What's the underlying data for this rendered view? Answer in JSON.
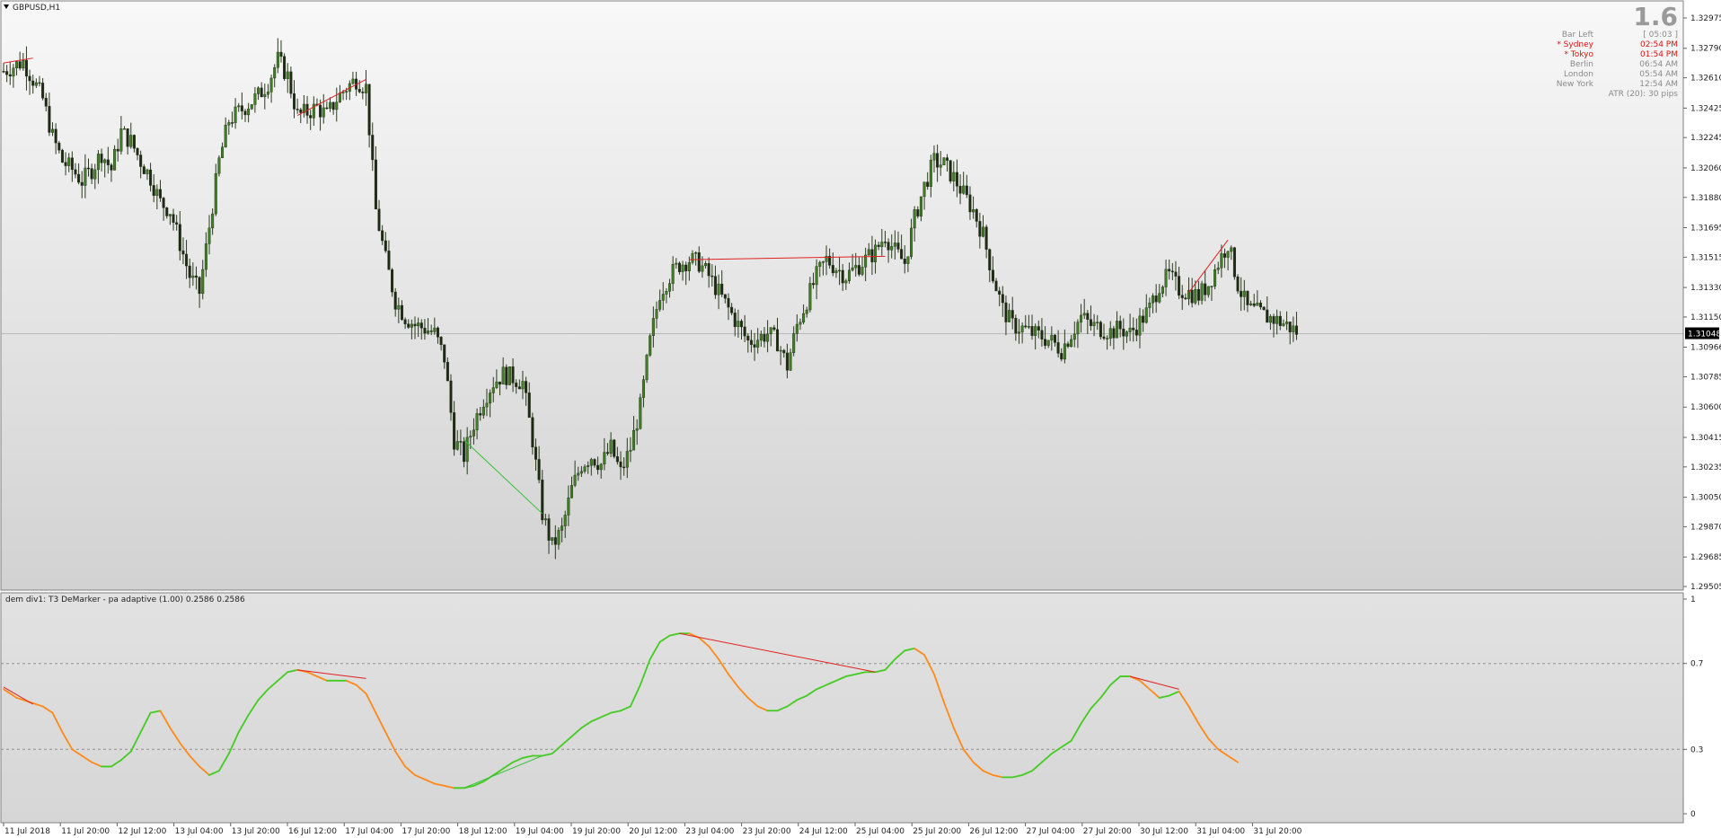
{
  "window": {
    "title": "GBPUSD,H1"
  },
  "indicator": {
    "label": "dem div1: T3 DeMarker - pa adaptive (1.00) 0.2586 0.2586"
  },
  "info_panel": {
    "big_value": "1.6",
    "bar_left_label": "Bar Left",
    "bar_left_value": "[ 05:03 ]",
    "clocks": [
      {
        "city": "* Sydney",
        "time": "02:54 PM",
        "highlight": true
      },
      {
        "city": "* Tokyo",
        "time": "01:54 PM",
        "highlight": true
      },
      {
        "city": "Berlin",
        "time": "06:54 AM",
        "highlight": false
      },
      {
        "city": "London",
        "time": "05:54 AM",
        "highlight": false
      },
      {
        "city": "New York",
        "time": "12:54 AM",
        "highlight": false
      }
    ],
    "atr": "ATR (20): 30 pips"
  },
  "price_axis": {
    "labels": [
      "1.32975",
      "1.32790",
      "1.32610",
      "1.32425",
      "1.32245",
      "1.32060",
      "1.31880",
      "1.31695",
      "1.31515",
      "1.31330",
      "1.31150",
      "1.30966",
      "1.30785",
      "1.30600",
      "1.30415",
      "1.30235",
      "1.30050",
      "1.29870",
      "1.29685",
      "1.29505"
    ],
    "current_price": "1.31048"
  },
  "indicator_axis": {
    "labels": [
      "1",
      "0.7",
      "0.3",
      "0"
    ],
    "levels": [
      0.7,
      0.3
    ]
  },
  "time_axis": {
    "labels": [
      "11 Jul 2018",
      "11 Jul 20:00",
      "12 Jul 12:00",
      "13 Jul 04:00",
      "13 Jul 20:00",
      "16 Jul 12:00",
      "17 Jul 04:00",
      "17 Jul 20:00",
      "18 Jul 12:00",
      "19 Jul 04:00",
      "19 Jul 20:00",
      "20 Jul 12:00",
      "23 Jul 04:00",
      "23 Jul 20:00",
      "24 Jul 12:00",
      "25 Jul 04:00",
      "25 Jul 20:00",
      "26 Jul 12:00",
      "27 Jul 04:00",
      "27 Jul 20:00",
      "30 Jul 12:00",
      "31 Jul 04:00",
      "31 Jul 20:00"
    ]
  },
  "colors": {
    "bull_candle": "#3f7f22",
    "bear_candle": "#1e2a14",
    "divergence_bearish": "#e02020",
    "divergence_bullish": "#30c030",
    "dem_up": "#44cc22",
    "dem_down": "#ff8a1a",
    "highlight_text": "#e01010"
  },
  "chart_data": {
    "type": "candlestick",
    "symbol": "GBPUSD",
    "timeframe": "H1",
    "ylim": [
      1.29505,
      1.32975
    ],
    "current_price": 1.31048,
    "price_path": [
      [
        0,
        1.3265
      ],
      [
        3,
        1.3268
      ],
      [
        6,
        1.3271
      ],
      [
        9,
        1.326
      ],
      [
        12,
        1.3248
      ],
      [
        15,
        1.3225
      ],
      [
        18,
        1.321
      ],
      [
        21,
        1.3205
      ],
      [
        24,
        1.3198
      ],
      [
        27,
        1.3205
      ],
      [
        30,
        1.3215
      ],
      [
        33,
        1.3205
      ],
      [
        36,
        1.3228
      ],
      [
        39,
        1.3222
      ],
      [
        42,
        1.321
      ],
      [
        45,
        1.32
      ],
      [
        48,
        1.3185
      ],
      [
        51,
        1.318
      ],
      [
        54,
        1.316
      ],
      [
        57,
        1.314
      ],
      [
        60,
        1.313
      ],
      [
        63,
        1.317
      ],
      [
        66,
        1.321
      ],
      [
        69,
        1.3235
      ],
      [
        72,
        1.324
      ],
      [
        75,
        1.3245
      ],
      [
        78,
        1.325
      ],
      [
        81,
        1.3258
      ],
      [
        84,
        1.3272
      ],
      [
        87,
        1.3262
      ],
      [
        90,
        1.3238
      ],
      [
        93,
        1.324
      ],
      [
        96,
        1.3243
      ],
      [
        99,
        1.3238
      ],
      [
        102,
        1.3248
      ],
      [
        105,
        1.3255
      ],
      [
        108,
        1.326
      ],
      [
        111,
        1.3255
      ],
      [
        114,
        1.318
      ],
      [
        117,
        1.315
      ],
      [
        120,
        1.3125
      ],
      [
        123,
        1.3115
      ],
      [
        126,
        1.311
      ],
      [
        129,
        1.3108
      ],
      [
        132,
        1.3105
      ],
      [
        135,
        1.309
      ],
      [
        138,
        1.304
      ],
      [
        141,
        1.303
      ],
      [
        144,
        1.305
      ],
      [
        147,
        1.3065
      ],
      [
        150,
        1.3075
      ],
      [
        153,
        1.308
      ],
      [
        156,
        1.3078
      ],
      [
        159,
        1.3075
      ],
      [
        162,
        1.304
      ],
      [
        165,
        1.2995
      ],
      [
        168,
        1.2975
      ],
      [
        171,
        1.2985
      ],
      [
        174,
        1.301
      ],
      [
        177,
        1.3025
      ],
      [
        180,
        1.303
      ],
      [
        183,
        1.3025
      ],
      [
        186,
        1.3035
      ],
      [
        189,
        1.302
      ],
      [
        192,
        1.3035
      ],
      [
        195,
        1.306
      ],
      [
        198,
        1.31
      ],
      [
        201,
        1.313
      ],
      [
        204,
        1.314
      ],
      [
        207,
        1.3147
      ],
      [
        210,
        1.315
      ],
      [
        213,
        1.3148
      ],
      [
        216,
        1.314
      ],
      [
        219,
        1.313
      ],
      [
        222,
        1.312
      ],
      [
        225,
        1.311
      ],
      [
        228,
        1.31
      ],
      [
        231,
        1.3102
      ],
      [
        234,
        1.3105
      ],
      [
        237,
        1.31
      ],
      [
        240,
        1.3085
      ],
      [
        243,
        1.311
      ],
      [
        246,
        1.3125
      ],
      [
        249,
        1.314
      ],
      [
        252,
        1.315
      ],
      [
        255,
        1.3145
      ],
      [
        258,
        1.314
      ],
      [
        261,
        1.3145
      ],
      [
        264,
        1.315
      ],
      [
        267,
        1.3155
      ],
      [
        270,
        1.3165
      ],
      [
        273,
        1.3155
      ],
      [
        276,
        1.3148
      ],
      [
        279,
        1.3175
      ],
      [
        282,
        1.3195
      ],
      [
        285,
        1.321
      ],
      [
        288,
        1.3208
      ],
      [
        291,
        1.32
      ],
      [
        294,
        1.319
      ],
      [
        297,
        1.318
      ],
      [
        300,
        1.3165
      ],
      [
        303,
        1.314
      ],
      [
        306,
        1.312
      ],
      [
        309,
        1.311
      ],
      [
        312,
        1.3108
      ],
      [
        315,
        1.3105
      ],
      [
        318,
        1.3103
      ],
      [
        321,
        1.31
      ],
      [
        324,
        1.3095
      ],
      [
        327,
        1.3105
      ],
      [
        330,
        1.3115
      ],
      [
        333,
        1.311
      ],
      [
        336,
        1.3108
      ],
      [
        339,
        1.3106
      ],
      [
        342,
        1.3108
      ],
      [
        345,
        1.3105
      ],
      [
        348,
        1.3112
      ],
      [
        351,
        1.312
      ],
      [
        354,
        1.3135
      ],
      [
        357,
        1.314
      ],
      [
        360,
        1.3132
      ],
      [
        363,
        1.313
      ],
      [
        366,
        1.3128
      ],
      [
        369,
        1.3135
      ],
      [
        372,
        1.3148
      ],
      [
        375,
        1.316
      ],
      [
        378,
        1.3135
      ],
      [
        381,
        1.312
      ],
      [
        384,
        1.3118
      ],
      [
        387,
        1.3115
      ],
      [
        390,
        1.3113
      ],
      [
        393,
        1.311
      ],
      [
        396,
        1.3106
      ]
    ],
    "bearish_divergences": [
      [
        [
          0,
          1.327
        ],
        [
          9,
          1.3273
        ]
      ],
      [
        [
          90,
          1.3238
        ],
        [
          111,
          1.326
        ]
      ],
      [
        [
          210,
          1.315
        ],
        [
          270,
          1.3152
        ]
      ],
      [
        [
          363,
          1.313
        ],
        [
          375,
          1.3162
        ]
      ]
    ],
    "bullish_divergences": [
      [
        [
          141,
          1.304
        ],
        [
          165,
          1.2995
        ]
      ]
    ],
    "indicator": {
      "name": "T3 DeMarker - pa adaptive",
      "ylim": [
        0,
        1
      ],
      "levels": [
        0.7,
        0.3
      ],
      "values": [
        [
          0,
          0.58
        ],
        [
          4,
          0.54
        ],
        [
          8,
          0.52
        ],
        [
          12,
          0.5
        ],
        [
          15,
          0.47
        ],
        [
          18,
          0.38
        ],
        [
          21,
          0.3
        ],
        [
          24,
          0.27
        ],
        [
          27,
          0.24
        ],
        [
          30,
          0.22
        ],
        [
          33,
          0.22
        ],
        [
          36,
          0.25
        ],
        [
          39,
          0.29
        ],
        [
          42,
          0.38
        ],
        [
          45,
          0.47
        ],
        [
          48,
          0.48
        ],
        [
          51,
          0.4
        ],
        [
          54,
          0.33
        ],
        [
          57,
          0.27
        ],
        [
          60,
          0.22
        ],
        [
          63,
          0.18
        ],
        [
          66,
          0.2
        ],
        [
          69,
          0.28
        ],
        [
          72,
          0.38
        ],
        [
          75,
          0.46
        ],
        [
          78,
          0.53
        ],
        [
          81,
          0.58
        ],
        [
          84,
          0.62
        ],
        [
          87,
          0.66
        ],
        [
          90,
          0.67
        ],
        [
          93,
          0.66
        ],
        [
          96,
          0.64
        ],
        [
          99,
          0.62
        ],
        [
          102,
          0.62
        ],
        [
          105,
          0.62
        ],
        [
          108,
          0.6
        ],
        [
          111,
          0.56
        ],
        [
          114,
          0.47
        ],
        [
          117,
          0.38
        ],
        [
          120,
          0.29
        ],
        [
          123,
          0.22
        ],
        [
          126,
          0.18
        ],
        [
          129,
          0.16
        ],
        [
          132,
          0.14
        ],
        [
          135,
          0.13
        ],
        [
          138,
          0.12
        ],
        [
          141,
          0.12
        ],
        [
          144,
          0.13
        ],
        [
          147,
          0.15
        ],
        [
          150,
          0.18
        ],
        [
          153,
          0.21
        ],
        [
          156,
          0.24
        ],
        [
          159,
          0.26
        ],
        [
          162,
          0.27
        ],
        [
          165,
          0.27
        ],
        [
          168,
          0.28
        ],
        [
          171,
          0.32
        ],
        [
          174,
          0.36
        ],
        [
          177,
          0.4
        ],
        [
          180,
          0.43
        ],
        [
          183,
          0.45
        ],
        [
          186,
          0.47
        ],
        [
          189,
          0.48
        ],
        [
          192,
          0.5
        ],
        [
          195,
          0.6
        ],
        [
          198,
          0.72
        ],
        [
          201,
          0.8
        ],
        [
          204,
          0.83
        ],
        [
          207,
          0.84
        ],
        [
          210,
          0.84
        ],
        [
          213,
          0.82
        ],
        [
          216,
          0.78
        ],
        [
          219,
          0.72
        ],
        [
          222,
          0.65
        ],
        [
          225,
          0.59
        ],
        [
          228,
          0.54
        ],
        [
          231,
          0.5
        ],
        [
          234,
          0.48
        ],
        [
          237,
          0.48
        ],
        [
          240,
          0.5
        ],
        [
          243,
          0.53
        ],
        [
          246,
          0.55
        ],
        [
          249,
          0.58
        ],
        [
          252,
          0.6
        ],
        [
          255,
          0.62
        ],
        [
          258,
          0.64
        ],
        [
          261,
          0.65
        ],
        [
          264,
          0.66
        ],
        [
          267,
          0.66
        ],
        [
          270,
          0.67
        ],
        [
          273,
          0.72
        ],
        [
          276,
          0.76
        ],
        [
          279,
          0.77
        ],
        [
          282,
          0.74
        ],
        [
          285,
          0.65
        ],
        [
          288,
          0.52
        ],
        [
          291,
          0.4
        ],
        [
          294,
          0.3
        ],
        [
          297,
          0.24
        ],
        [
          300,
          0.2
        ],
        [
          303,
          0.18
        ],
        [
          306,
          0.17
        ],
        [
          309,
          0.17
        ],
        [
          312,
          0.18
        ],
        [
          315,
          0.2
        ],
        [
          318,
          0.24
        ],
        [
          321,
          0.28
        ],
        [
          324,
          0.31
        ],
        [
          327,
          0.34
        ],
        [
          330,
          0.42
        ],
        [
          333,
          0.49
        ],
        [
          336,
          0.54
        ],
        [
          339,
          0.6
        ],
        [
          342,
          0.64
        ],
        [
          345,
          0.64
        ],
        [
          348,
          0.62
        ],
        [
          351,
          0.58
        ],
        [
          354,
          0.54
        ],
        [
          357,
          0.55
        ],
        [
          360,
          0.57
        ],
        [
          363,
          0.5
        ],
        [
          366,
          0.42
        ],
        [
          369,
          0.35
        ],
        [
          372,
          0.3
        ],
        [
          375,
          0.27
        ],
        [
          378,
          0.24
        ]
      ],
      "bearish_divergences": [
        [
          [
            0,
            0.59
          ],
          [
            9,
            0.51
          ]
        ],
        [
          [
            90,
            0.67
          ],
          [
            111,
            0.63
          ]
        ],
        [
          [
            207,
            0.84
          ],
          [
            267,
            0.66
          ]
        ],
        [
          [
            345,
            0.64
          ],
          [
            360,
            0.58
          ]
        ]
      ],
      "bullish_divergences": [
        [
          [
            141,
            0.12
          ],
          [
            165,
            0.27
          ]
        ]
      ]
    }
  }
}
